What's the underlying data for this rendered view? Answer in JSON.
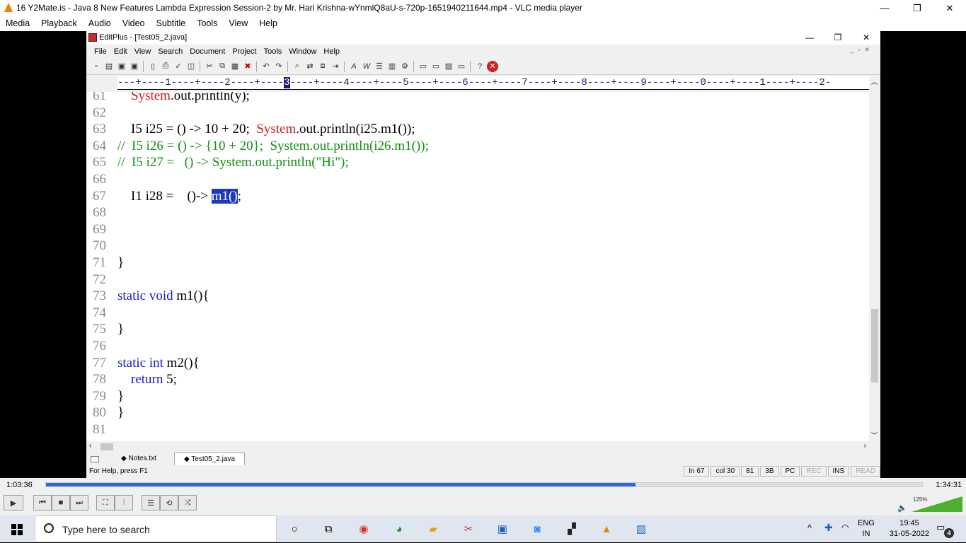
{
  "vlc": {
    "title": "16 Y2Mate.is - Java 8 New Features  Lambda Expression  Session-2  by Mr. Hari Krishna-wYnmlQ8aU-s-720p-1651940211644.mp4 - VLC media player",
    "menu": [
      "Media",
      "Playback",
      "Audio",
      "Video",
      "Subtitle",
      "Tools",
      "View",
      "Help"
    ],
    "window_controls": [
      "—",
      "❐",
      "✕"
    ],
    "time_elapsed": "1:03:36",
    "time_total": "1:34:31",
    "progress_fraction": 0.673,
    "volume_label": "125%",
    "volume_fraction": 1.0,
    "accent": "#2a6cd6"
  },
  "editplus": {
    "title": "EditPlus - [Test05_2.java]",
    "menu": [
      "File",
      "Edit",
      "View",
      "Search",
      "Document",
      "Project",
      "Tools",
      "Window",
      "Help"
    ],
    "ruler": "---+----1----+----2----+----3----+----4----+----5----+----6----+----7----+----8----+----9----+----0----+----1----+----2-",
    "ruler_highlight": "3",
    "lines": [
      {
        "n": "61",
        "parts": [
          {
            "t": "    ",
            "c": ""
          },
          {
            "t": "System",
            "c": "red"
          },
          {
            "t": ".out.println(y);",
            "c": ""
          }
        ]
      },
      {
        "n": "62",
        "parts": []
      },
      {
        "n": "63",
        "parts": [
          {
            "t": "    I5 i25 = () -> 10 + 20;  ",
            "c": ""
          },
          {
            "t": "System",
            "c": "red"
          },
          {
            "t": ".out.println(i25.m1());",
            "c": ""
          }
        ]
      },
      {
        "n": "64",
        "parts": [
          {
            "t": "//  I5 i26 = () -> {10 + 20};  System.out.println(i26.m1());",
            "c": "cm"
          }
        ]
      },
      {
        "n": "65",
        "parts": [
          {
            "t": "//  I5 i27 =   () -> System.out.println(\"Hi\");",
            "c": "cm"
          }
        ]
      },
      {
        "n": "66",
        "parts": []
      },
      {
        "n": "67",
        "parts": [
          {
            "t": "    I1 i28 =    ()-> ",
            "c": ""
          },
          {
            "t": "m1()",
            "c": "sel"
          },
          {
            "t": ";",
            "c": ""
          }
        ]
      },
      {
        "n": "68",
        "parts": []
      },
      {
        "n": "69",
        "parts": []
      },
      {
        "n": "70",
        "parts": []
      },
      {
        "n": "71",
        "parts": [
          {
            "t": "}",
            "c": ""
          }
        ]
      },
      {
        "n": "72",
        "parts": []
      },
      {
        "n": "73",
        "parts": [
          {
            "t": "static void",
            "c": "kw"
          },
          {
            "t": " m1(){",
            "c": ""
          }
        ]
      },
      {
        "n": "74",
        "parts": []
      },
      {
        "n": "75",
        "parts": [
          {
            "t": "}",
            "c": ""
          }
        ]
      },
      {
        "n": "76",
        "parts": []
      },
      {
        "n": "77",
        "parts": [
          {
            "t": "static int",
            "c": "kw"
          },
          {
            "t": " m2(){",
            "c": ""
          }
        ]
      },
      {
        "n": "78",
        "parts": [
          {
            "t": "    ",
            "c": ""
          },
          {
            "t": "return",
            "c": "kw"
          },
          {
            "t": " 5;",
            "c": ""
          }
        ]
      },
      {
        "n": "79",
        "parts": [
          {
            "t": "}",
            "c": ""
          }
        ]
      },
      {
        "n": "80",
        "parts": [
          {
            "t": "}",
            "c": ""
          }
        ]
      },
      {
        "n": "81",
        "parts": []
      }
    ],
    "tabs": [
      "Notes.txt",
      "Test05_2.java"
    ],
    "status_help": "For Help, press F1",
    "status_cells": [
      "In 67",
      "col 30",
      "81",
      "3B",
      "PC",
      "REC",
      "INS",
      "READ"
    ]
  },
  "taskbar": {
    "search_placeholder": "Type here to search",
    "lang_line1": "ENG",
    "lang_line2": "IN",
    "time": "19:45",
    "date": "31-05-2022",
    "notif_count": "4"
  }
}
